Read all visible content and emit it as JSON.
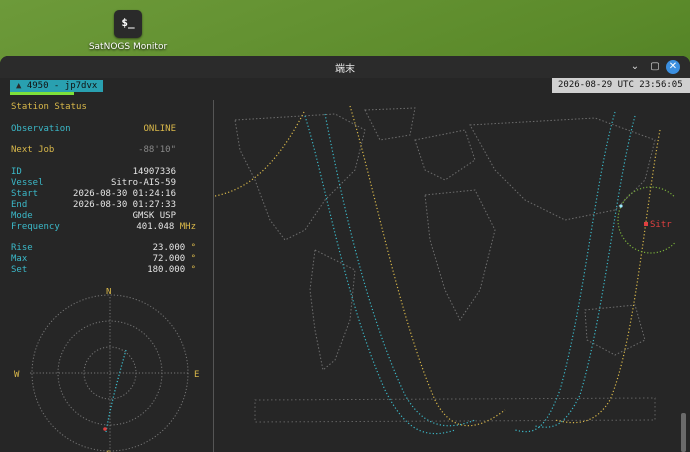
{
  "desktop": {
    "icon_glyph": "$_",
    "icon_label": "SatNOGS Monitor"
  },
  "window": {
    "title": "端末"
  },
  "topbar": {
    "indicator": "▲",
    "station": "4950 - jp7dvx",
    "datetime": "2026-08-29 UTC 23:56:05"
  },
  "status": {
    "heading": "Station Status",
    "observation_label": "Observation",
    "observation_value": "ONLINE",
    "next_job_label": "Next Job",
    "next_job_value": "-88'10\"",
    "id_label": "ID",
    "id_value": "14907336",
    "vessel_label": "Vessel",
    "vessel_value": "Sitro-AIS-59",
    "start_label": "Start",
    "start_value": "2026-08-30 01:24:16",
    "end_label": "End",
    "end_value": "2026-08-30 01:27:33",
    "mode_label": "Mode",
    "mode_value": "GMSK USP",
    "freq_label": "Frequency",
    "freq_value": "401.048",
    "freq_unit": "MHz",
    "rise_label": "Rise",
    "rise_value": "23.000",
    "deg": "°",
    "max_label": "Max",
    "max_value": "72.000",
    "set_label": "Set",
    "set_value": "180.000"
  },
  "polar": {
    "n": "N",
    "e": "E",
    "s": "S",
    "w": "W"
  },
  "map": {
    "sat_label": "Sitr"
  },
  "colors": {
    "cyan": "#3bb9c9",
    "yellow": "#d9b84a",
    "green": "#7ee03a",
    "red": "#e04040"
  }
}
